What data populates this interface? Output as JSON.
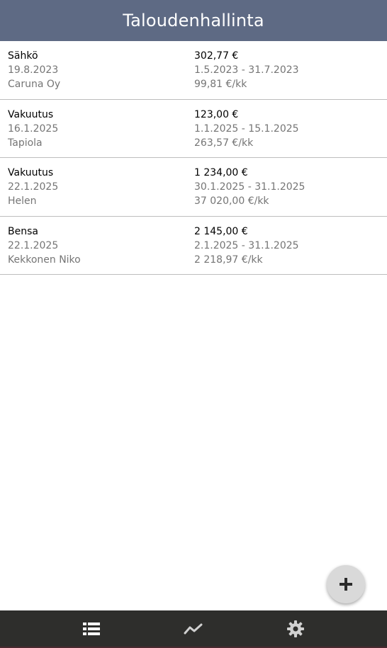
{
  "header": {
    "title": "Taloudenhallinta"
  },
  "entries": [
    {
      "category": "Sähkö",
      "date": "19.8.2023",
      "payee": "Caruna Oy",
      "amount": "302,77 €",
      "period": "1.5.2023 - 31.7.2023",
      "monthly": "99,81 €/kk"
    },
    {
      "category": "Vakuutus",
      "date": "16.1.2025",
      "payee": "Tapiola",
      "amount": "123,00 €",
      "period": "1.1.2025 - 15.1.2025",
      "monthly": "263,57 €/kk"
    },
    {
      "category": "Vakuutus",
      "date": "22.1.2025",
      "payee": "Helen",
      "amount": "1 234,00 €",
      "period": "30.1.2025 - 31.1.2025",
      "monthly": "37 020,00 €/kk"
    },
    {
      "category": "Bensa",
      "date": "22.1.2025",
      "payee": "Kekkonen Niko",
      "amount": "2 145,00 €",
      "period": "2.1.2025 - 31.1.2025",
      "monthly": "2 218,97 €/kk"
    }
  ],
  "fab": {
    "icon": "plus-icon"
  },
  "bottom_nav": {
    "items": [
      {
        "icon": "list-icon",
        "active": true
      },
      {
        "icon": "chart-line-icon",
        "active": false
      },
      {
        "icon": "gear-icon",
        "active": false
      }
    ]
  },
  "colors": {
    "header_bg": "#5e6a84",
    "nav_bg": "#2e2e2c",
    "fab_bg": "#d9d9d9",
    "divider": "#bdbdbd"
  }
}
